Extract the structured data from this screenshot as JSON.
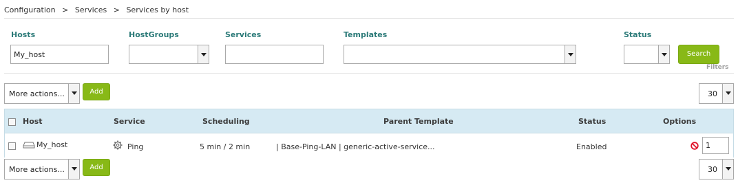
{
  "breadcrumb": {
    "items": [
      "Configuration",
      "Services",
      "Services by host"
    ],
    "separator": ">"
  },
  "filters": {
    "hosts": {
      "label": "Hosts",
      "value": "My_host"
    },
    "hostgroups": {
      "label": "HostGroups",
      "value": ""
    },
    "services": {
      "label": "Services",
      "value": ""
    },
    "templates": {
      "label": "Templates",
      "value": ""
    },
    "status": {
      "label": "Status",
      "value": ""
    },
    "search_label": "Search",
    "panel_label": "Filters"
  },
  "top_actions": {
    "more_actions": "More actions...",
    "add_label": "Add",
    "page_size": "30"
  },
  "bottom_actions": {
    "more_actions": "More actions...",
    "add_label": "Add",
    "page_size": "30"
  },
  "table": {
    "columns": [
      "Host",
      "Service",
      "Scheduling",
      "Parent Template",
      "Status",
      "Options"
    ],
    "rows": [
      {
        "host": "My_host",
        "service": "Ping",
        "scheduling": "5 min / 2 min",
        "parent_template": "| Base-Ping-LAN | generic-active-service...",
        "status": "Enabled",
        "options_value": "1"
      }
    ]
  },
  "colors": {
    "accent_green": "#88b917",
    "filter_label": "#2b7a78",
    "table_header_bg": "#d6eaf3",
    "disable_icon": "#e0142b"
  },
  "icons": {
    "host": "host-icon",
    "service": "gear-icon",
    "disable": "disable-icon",
    "dropdown": "chevron-down-icon"
  }
}
